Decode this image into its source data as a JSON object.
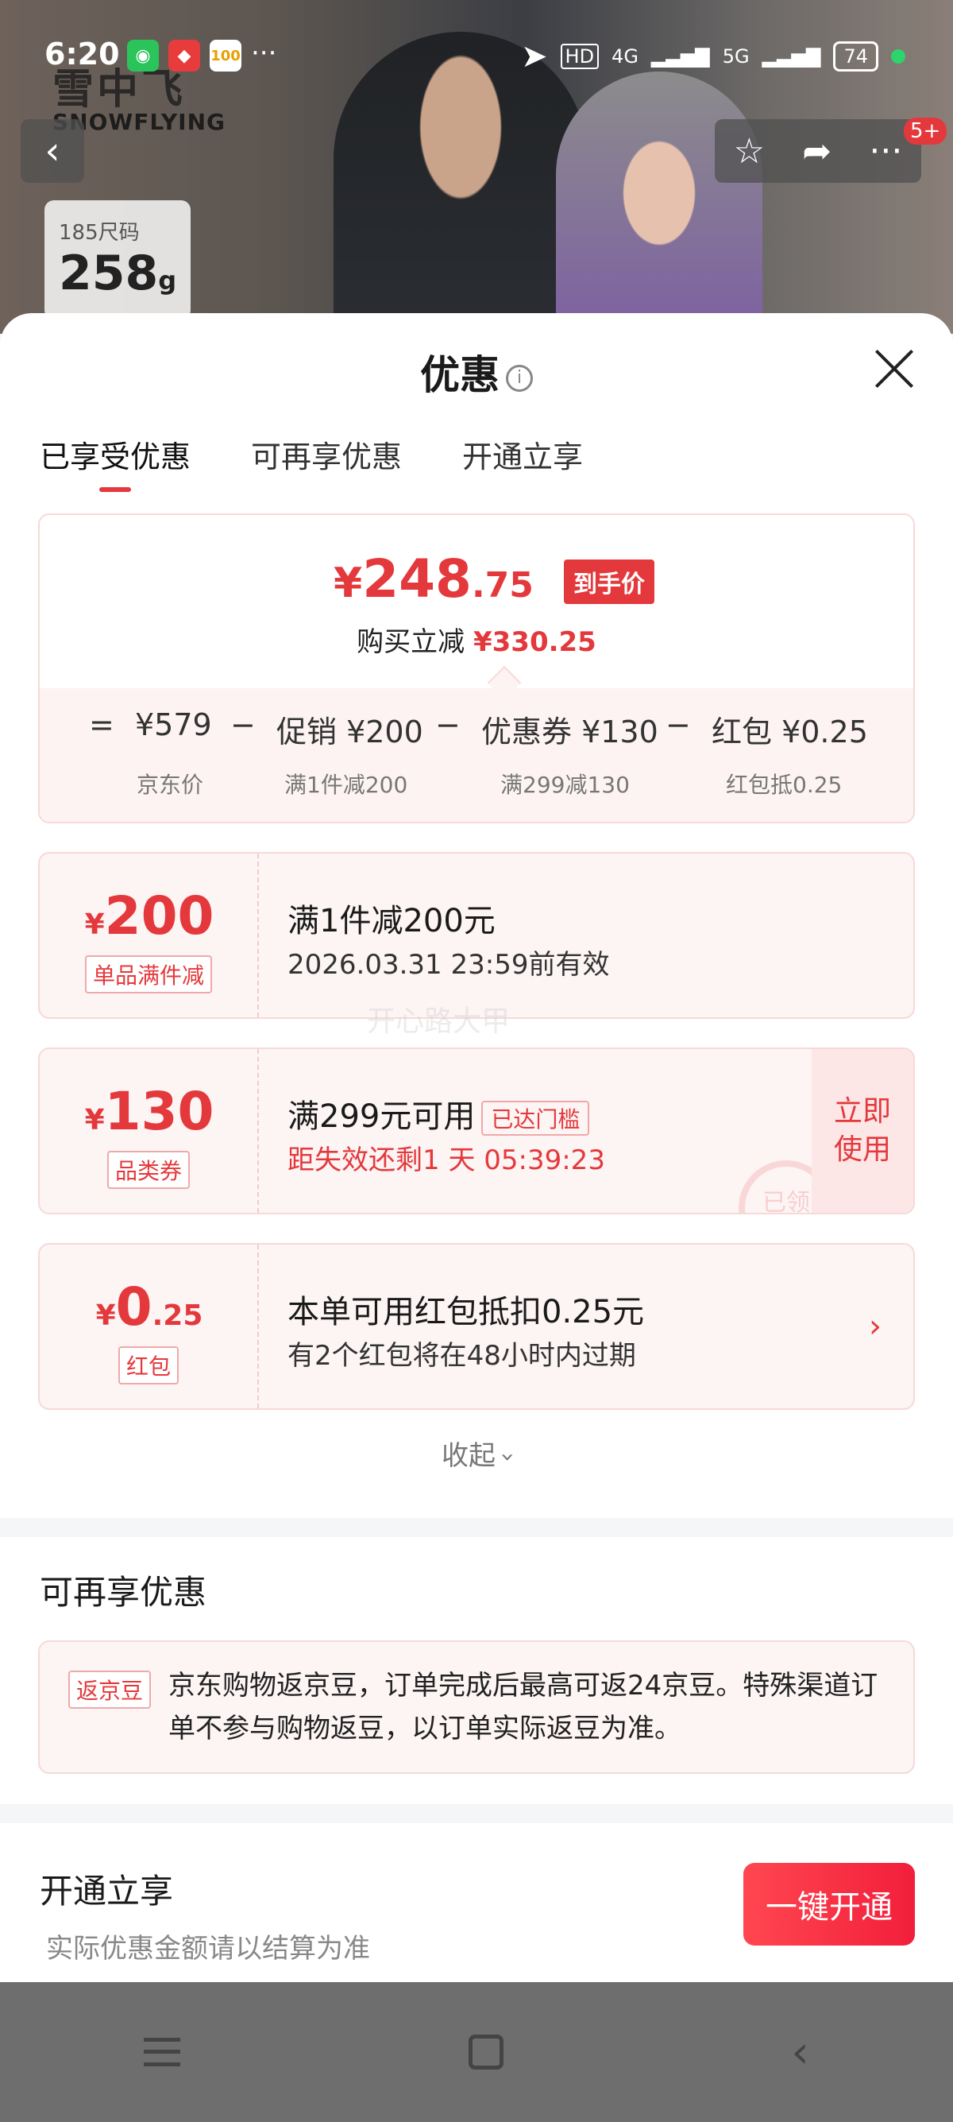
{
  "status_bar": {
    "time": "6:20",
    "network1": "HD",
    "network2": "4G",
    "network3": "5G",
    "battery": "74"
  },
  "hero": {
    "brand_cn": "雪中飞",
    "brand_en": "SNOWFLYING",
    "size_label": "185尺码",
    "weight_value": "258",
    "weight_unit": "g",
    "more_badge": "5+"
  },
  "sheet": {
    "title": "优惠",
    "info_icon": "i",
    "tabs": [
      {
        "label": "已享受优惠"
      },
      {
        "label": "可再享优惠"
      },
      {
        "label": "开通立享"
      }
    ],
    "summary": {
      "currency": "¥",
      "price_int": "248",
      "price_dec": ".75",
      "price_tag": "到手价",
      "save_label": "购买立减",
      "save_amount": "¥330.25",
      "eq_sign": "=",
      "jd_price": "¥579",
      "jd_price_label": "京东价",
      "minus": "−",
      "promo": "促销 ¥200",
      "promo_label": "满1件减200",
      "coupon": "优惠券 ¥130",
      "coupon_label": "满299减130",
      "redpacket": "红包 ¥0.25",
      "redpacket_label": "红包抵0.25"
    },
    "coupons": [
      {
        "cur": "¥",
        "amount": "200",
        "amount_dec": "",
        "tag": "单品满件减",
        "line1": "满1件减200元",
        "line2": "2026.03.31 23:59前有效"
      },
      {
        "cur": "¥",
        "amount": "130",
        "amount_dec": "",
        "tag": "品类券",
        "line1": "满299元可用",
        "reached": "已达门槛",
        "line2": "距失效还剩1 天 05:39:23",
        "use_btn": "立即使用",
        "stamp": "已领"
      },
      {
        "cur": "¥",
        "amount": "0",
        "amount_dec": ".25",
        "tag": "红包",
        "line1": "本单可用红包抵扣0.25元",
        "line2": "有2个红包将在48小时内过期",
        "arrow": "›"
      }
    ],
    "watermark": "开心路大甲",
    "collapse": "收起",
    "more_section": {
      "title": "可再享优惠",
      "bean_tag": "返京豆",
      "bean_text": "京东购物返京豆，订单完成后最高可返24京豆。特殊渠道订单不参与购物返豆，以订单实际返豆为准。"
    },
    "open_section": {
      "title": "开通立享",
      "subtitle": "实际优惠金额请以结算为准",
      "button": "一键开通"
    }
  },
  "colors": {
    "accent": "#e4393c",
    "card_bg": "#fdf4f4",
    "card_border": "#f7d9d9"
  }
}
